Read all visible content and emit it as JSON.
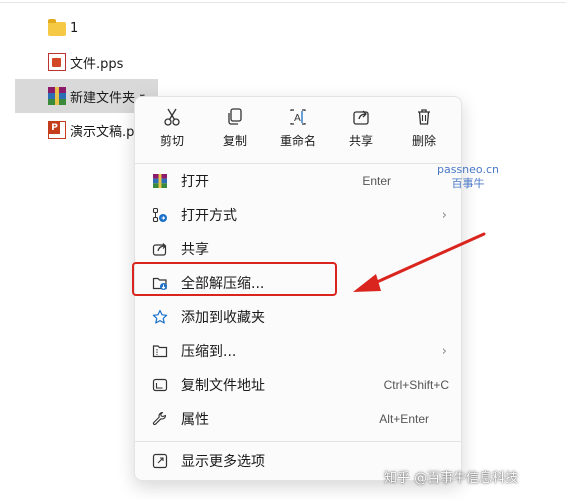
{
  "files": [
    {
      "name": "1",
      "icon": "folder-icon"
    },
    {
      "name": "文件.pps",
      "icon": "pps-file-icon"
    },
    {
      "name": "新建文件夹.r",
      "icon": "rar-archive-icon",
      "selected": true
    },
    {
      "name": "演示文稿.pp",
      "icon": "ppt-file-icon"
    }
  ],
  "quick_actions": [
    {
      "label": "剪切",
      "icon": "scissors-icon"
    },
    {
      "label": "复制",
      "icon": "copy-icon"
    },
    {
      "label": "重命名",
      "icon": "rename-icon"
    },
    {
      "label": "共享",
      "icon": "share-icon"
    },
    {
      "label": "删除",
      "icon": "trash-icon"
    }
  ],
  "watermark_site": {
    "line1": "passneo.cn",
    "line2": "百事牛"
  },
  "menu_items": [
    {
      "label": "打开",
      "shortcut": "Enter",
      "icon": "winrar-icon"
    },
    {
      "label": "打开方式",
      "has_submenu": true,
      "icon": "open-with-icon"
    },
    {
      "label": "共享",
      "icon": "share-icon"
    },
    {
      "label": "全部解压缩...",
      "icon": "extract-all-icon",
      "highlighted": true
    },
    {
      "label": "添加到收藏夹",
      "icon": "star-icon"
    },
    {
      "label": "压缩到...",
      "has_submenu": true,
      "icon": "compress-to-icon"
    },
    {
      "label": "复制文件地址",
      "shortcut": "Ctrl+Shift+C",
      "icon": "copy-path-icon"
    },
    {
      "label": "属性",
      "shortcut": "Alt+Enter",
      "icon": "wrench-icon"
    },
    {
      "label": "显示更多选项",
      "icon": "more-options-icon"
    }
  ],
  "footer_watermark": "知乎 @百事牛信息科技",
  "colors": {
    "highlight": "#d9251d",
    "accent": "#1a6fc9",
    "menu_bg": "#fbfbfb"
  }
}
